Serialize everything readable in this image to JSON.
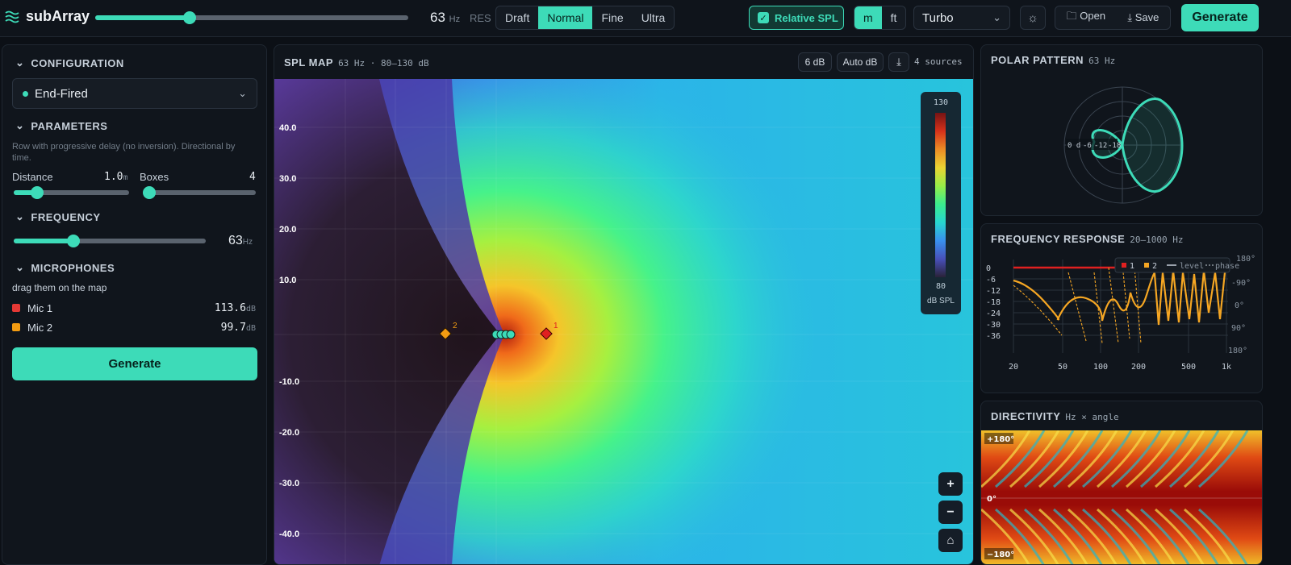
{
  "app": {
    "title": "subArray"
  },
  "topbar": {
    "frequency_value": "63",
    "frequency_unit": "Hz",
    "res_label": "RES",
    "res_options": [
      "Draft",
      "Normal",
      "Fine",
      "Ultra"
    ],
    "relative_spl": "Relative SPL",
    "units": [
      "m",
      "ft"
    ],
    "colormap": "Turbo",
    "open": "Open",
    "save": "Save",
    "generate": "Generate"
  },
  "config": {
    "title": "CONFIGURATION",
    "preset": "End-Fired",
    "params_title": "PARAMETERS",
    "description": "Row with progressive delay (no inversion). Directional by time.",
    "distance_label": "Distance",
    "distance_value": "1.0",
    "distance_unit": "m",
    "distance_fraction": 0.2,
    "boxes_label": "Boxes",
    "boxes_value": "4",
    "boxes_fraction": 0.03,
    "freq_title": "FREQUENCY",
    "freq_value": "63",
    "freq_unit": "Hz",
    "freq_fraction": 0.31,
    "mics_title": "MICROPHONES",
    "mics_hint": "drag them on the map",
    "mics": [
      {
        "name": "Mic 1",
        "value": "113.6",
        "unit": "dB",
        "color": "#e53935"
      },
      {
        "name": "Mic 2",
        "value": "99.7",
        "unit": "dB",
        "color": "#f39c12"
      }
    ],
    "generate": "Generate"
  },
  "splmap": {
    "title": "SPL MAP",
    "subtitle": "63 Hz · 80–130 dB",
    "range_btn": "6 dB",
    "auto_btn": "Auto dB",
    "sources": "4 sources",
    "y_ticks": [
      "40.0",
      "30.0",
      "20.0",
      "10.0",
      "-10.0",
      "-20.0",
      "-30.0",
      "-40.0"
    ],
    "legend_max": "130",
    "legend_min": "80",
    "legend_unit": "dB SPL",
    "mic1_label": "1",
    "mic2_label": "2",
    "zoom_in": "+",
    "zoom_out": "−",
    "home": "⌂"
  },
  "polar": {
    "title": "POLAR PATTERN",
    "sub": "63 Hz",
    "rings": [
      "0 d",
      "-6",
      "-12",
      "-18"
    ]
  },
  "freqresp": {
    "title": "FREQUENCY RESPONSE",
    "sub": "20–1000 Hz",
    "y_ticks": [
      "0",
      "-6",
      "-12",
      "-18",
      "-24",
      "-30",
      "-36"
    ],
    "phase_ticks": [
      "180°",
      "-90°",
      "0°",
      "90°",
      "180°"
    ],
    "x_ticks": [
      "20",
      "50",
      "100",
      "200",
      "500",
      "1k"
    ],
    "legend": {
      "s1": "1",
      "s2": "2",
      "level": "level",
      "phase": "phase"
    }
  },
  "directivity": {
    "title": "DIRECTIVITY",
    "sub": "Hz × angle",
    "labels": [
      "+180°",
      "0°",
      "−180°"
    ]
  },
  "colors": {
    "accent": "#3ddbb8",
    "bg": "#0c1016",
    "panel": "#10151c"
  }
}
